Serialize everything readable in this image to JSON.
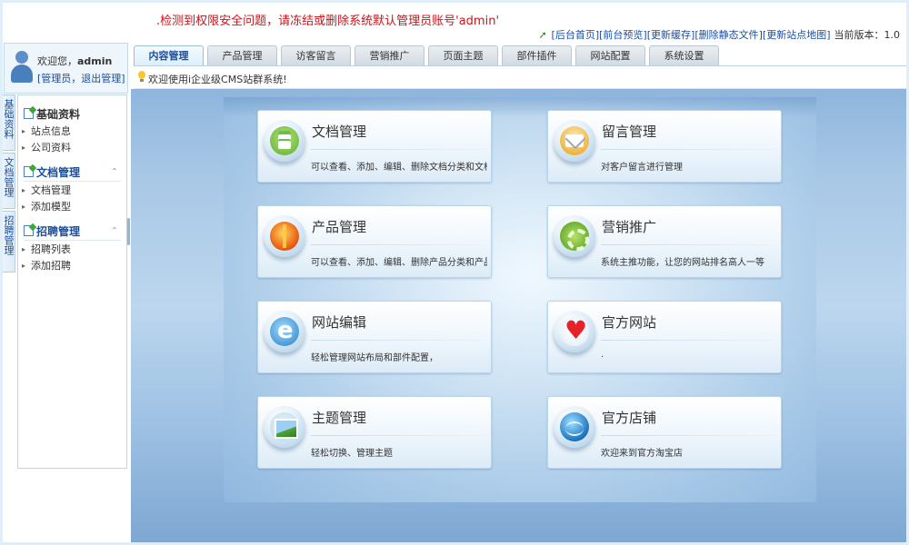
{
  "warning": ".检测到权限安全问题，请冻结或删除系统默认管理员账号'admin'",
  "top_links": {
    "items": [
      "[后台首页]",
      "[前台预览]",
      "[更新缓存]",
      "[删除静态文件]",
      "[更新站点地图]"
    ],
    "version_label": "当前版本：",
    "version_value": "1.0"
  },
  "user": {
    "greeting": "欢迎您，",
    "name": "admin",
    "links_open": "[",
    "role_link": "管理员",
    "comma": "，",
    "logout_link": "退出管理",
    "links_close": "]"
  },
  "tabs": [
    "内容管理",
    "产品管理",
    "访客留言",
    "营销推广",
    "页面主题",
    "部件插件",
    "网站配置",
    "系统设置"
  ],
  "active_tab": "内容管理",
  "notice": "欢迎使用i企业级CMS站群系统!",
  "vtabs": [
    "基础资料",
    "文档管理",
    "招聘管理"
  ],
  "sidebar": {
    "sections": [
      {
        "title": "基础资料",
        "items": [
          "站点信息",
          "公司资料"
        ]
      },
      {
        "title": "文档管理",
        "items": [
          "文档管理",
          "添加模型"
        ]
      },
      {
        "title": "招聘管理",
        "items": [
          "招聘列表",
          "添加招聘"
        ]
      }
    ]
  },
  "cards": [
    {
      "title": "文档管理",
      "desc": "可以查看、添加、编辑、删除文档分类和文档内容。",
      "icon": "document-icon"
    },
    {
      "title": "留言管理",
      "desc": "对客户留言进行管理",
      "icon": "envelope-icon"
    },
    {
      "title": "产品管理",
      "desc": "可以查看、添加、编辑、删除产品分类和产品介绍。",
      "icon": "product-icon"
    },
    {
      "title": "营销推广",
      "desc": "系统主推功能，让您的网站排名高人一等",
      "icon": "gear-icon"
    },
    {
      "title": "网站编辑",
      "desc": "轻松管理网站布局和部件配置，",
      "icon": "browser-e-icon"
    },
    {
      "title": "官方网站",
      "desc": ".",
      "icon": "heart-icon"
    },
    {
      "title": "主题管理",
      "desc": "轻松切换、管理主题",
      "icon": "picture-icon"
    },
    {
      "title": "官方店铺",
      "desc": "欢迎来到官方淘宝店",
      "icon": "globe-icon"
    }
  ]
}
